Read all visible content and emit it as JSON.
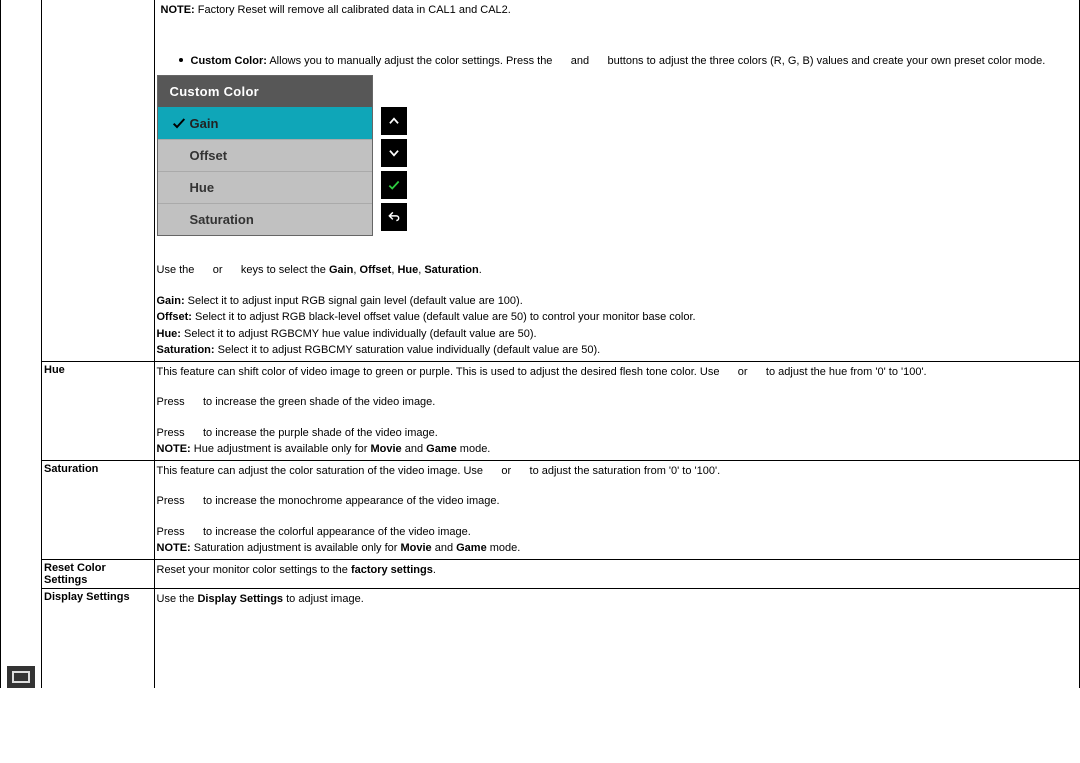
{
  "top": {
    "note_label": "NOTE:",
    "note_text": " Factory Reset will remove all calibrated data in CAL1 and CAL2.",
    "custom_color_label": "Custom Color:",
    "custom_color_text_1": " Allows you to manually adjust the color settings. Press the ",
    "custom_color_text_and": " and ",
    "custom_color_text_2": " buttons to adjust the three colors (R, G, B) values and create your own preset color mode."
  },
  "osd": {
    "title": "Custom Color",
    "items": [
      "Gain",
      "Offset",
      "Hue",
      "Saturation"
    ]
  },
  "instr": {
    "use_keys_1": "Use the ",
    "use_keys_or": " or ",
    "use_keys_2": " keys to select the ",
    "k_gain": "Gain",
    "k_offset": "Offset",
    "k_hue": "Hue",
    "k_sat": "Saturation",
    "gain_label": "Gain:",
    "gain_text": " Select it to adjust input RGB signal gain level (default value are 100).",
    "offset_label": "Offset:",
    "offset_text": " Select it to adjust RGB black-level offset value (default value are 50) to control your monitor base color.",
    "hue_label": "Hue:",
    "hue_text": " Select it to adjust RGBCMY hue value individually (default value are 50).",
    "sat_label": "Saturation:",
    "sat_text": " Select it to adjust RGBCMY saturation value individually (default value are 50)."
  },
  "rows": {
    "hue": {
      "label": "Hue",
      "p1a": "This feature can shift color of video image to green or purple. This is used to adjust the desired flesh tone color. Use ",
      "p1b": " or ",
      "p1c": " to adjust the hue from '0' to '100'.",
      "p2a": "Press ",
      "p2b": " to increase the green shade of the video image.",
      "p3a": "Press ",
      "p3b": " to increase the purple shade of the video image.",
      "note_label": "NOTE:",
      "note_a": " Hue adjustment is available only for ",
      "note_movie": "Movie",
      "note_and": " and ",
      "note_game": "Game",
      "note_end": " mode."
    },
    "saturation": {
      "label": "Saturation",
      "p1a": "This feature can adjust the color saturation of the video image. Use ",
      "p1b": " or ",
      "p1c": " to adjust the saturation from '0' to '100'.",
      "p2a": "Press ",
      "p2b": " to increase the monochrome appearance of the video image.",
      "p3a": "Press ",
      "p3b": " to increase the colorful appearance of the video image.",
      "note_label": "NOTE:",
      "note_a": " Saturation adjustment is available only for ",
      "note_movie": "Movie",
      "note_and": " and ",
      "note_game": "Game",
      "note_end": " mode."
    },
    "reset": {
      "label": "Reset Color Settings",
      "text_a": "Reset your monitor color settings to the ",
      "text_b": "factory settings",
      "text_c": "."
    },
    "display": {
      "label": "Display Settings",
      "text_a": "Use the ",
      "text_b": "Display Settings",
      "text_c": " to adjust image."
    }
  }
}
